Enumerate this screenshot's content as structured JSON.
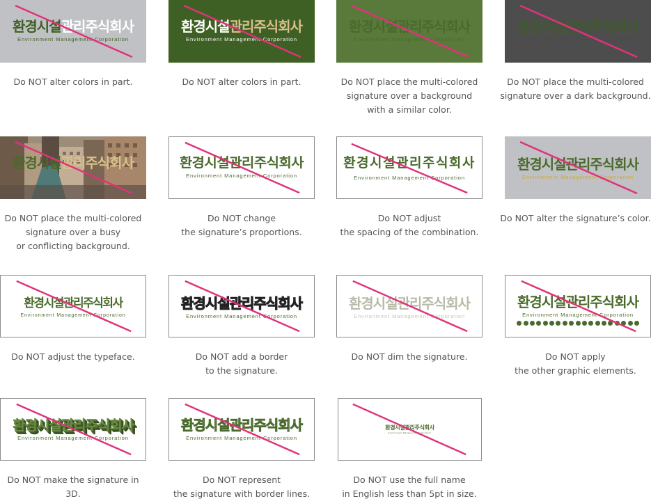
{
  "logo": {
    "korean": "환경시설관리주식회사",
    "korean_part1": "환경시설",
    "korean_part2": "관리주식회사",
    "english": "Environment Management Corporation"
  },
  "colors": {
    "brand_green": "#4a6a2b",
    "accent_gold": "#d9c08a",
    "slash_pink": "#e0327a",
    "gray_bg": "#bfc1c4",
    "green_bg": "#3f6024",
    "mid_green_bg": "#5a7a3c",
    "dark_bg": "#4d4d4d"
  },
  "tiles": [
    {
      "caption": "Do NOT alter colors in part."
    },
    {
      "caption": "Do NOT alter colors in part."
    },
    {
      "caption": "Do NOT place the multi-colored\nsignature over a background\nwith a similar color."
    },
    {
      "caption": "Do NOT place the multi-colored\nsignature over a dark background."
    },
    {
      "caption": "Do NOT place the multi-colored\nsignature over a busy\nor conflicting background."
    },
    {
      "caption": "Do NOT change\nthe signature’s proportions."
    },
    {
      "caption": "Do NOT adjust\nthe spacing of the combination."
    },
    {
      "caption": "Do NOT alter the signature’s color."
    },
    {
      "caption": "Do NOT adjust the typeface."
    },
    {
      "caption": "Do NOT add a border\nto the signature."
    },
    {
      "caption": "Do NOT dim the signature."
    },
    {
      "caption": "Do NOT apply\nthe other graphic elements."
    },
    {
      "caption": "Do NOT make the signature in 3D."
    },
    {
      "caption": "Do NOT represent\nthe signature with border lines."
    },
    {
      "caption": "Do NOT use the full name\nin English less than 5pt in size."
    }
  ]
}
